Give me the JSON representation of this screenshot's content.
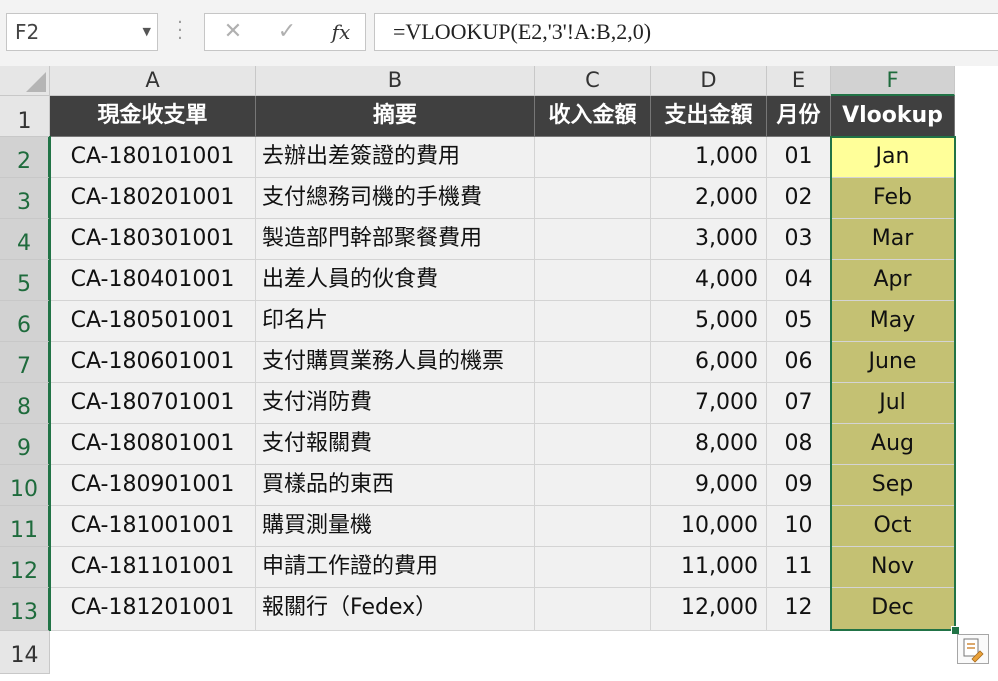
{
  "name_box": "F2",
  "formula_bar": {
    "cancel_icon": "✕",
    "enter_icon": "✓",
    "function_icon": "fx",
    "formula": "=VLOOKUP(E2,'3'!A:B,2,0)"
  },
  "columns": [
    "A",
    "B",
    "C",
    "D",
    "E",
    "F"
  ],
  "row_numbers": [
    "1",
    "2",
    "3",
    "4",
    "5",
    "6",
    "7",
    "8",
    "9",
    "10",
    "11",
    "12",
    "13",
    "14"
  ],
  "table": {
    "headers": [
      "現金收支單",
      "摘要",
      "收入金額",
      "支出金額",
      "月份",
      "Vlookup"
    ],
    "rows": [
      [
        "CA-180101001",
        "去辦出差簽證的費用",
        "",
        "1,000",
        "01",
        "Jan"
      ],
      [
        "CA-180201001",
        "支付總務司機的手機費",
        "",
        "2,000",
        "02",
        "Feb"
      ],
      [
        "CA-180301001",
        "製造部門幹部聚餐費用",
        "",
        "3,000",
        "03",
        "Mar"
      ],
      [
        "CA-180401001",
        "出差人員的伙食費",
        "",
        "4,000",
        "04",
        "Apr"
      ],
      [
        "CA-180501001",
        "印名片",
        "",
        "5,000",
        "05",
        "May"
      ],
      [
        "CA-180601001",
        "支付購買業務人員的機票",
        "",
        "6,000",
        "06",
        "June"
      ],
      [
        "CA-180701001",
        "支付消防費",
        "",
        "7,000",
        "07",
        "Jul"
      ],
      [
        "CA-180801001",
        "支付報關費",
        "",
        "8,000",
        "08",
        "Aug"
      ],
      [
        "CA-180901001",
        "買樣品的東西",
        "",
        "9,000",
        "09",
        "Sep"
      ],
      [
        "CA-181001001",
        "購買測量機",
        "",
        "10,000",
        "10",
        "Oct"
      ],
      [
        "CA-181101001",
        "申請工作證的費用",
        "",
        "11,000",
        "11",
        "Nov"
      ],
      [
        "CA-181201001",
        "報關行（Fedex）",
        "",
        "12,000",
        "12",
        "Dec"
      ]
    ]
  },
  "colors": {
    "header_fill": "#404040",
    "lookup_fill": "#c4c173",
    "active_cell_fill": "#ffff99",
    "selection_border": "#217346"
  },
  "icons": {
    "name_box_dropdown": "chevron-down-icon",
    "quick_analysis": "quick-analysis-icon"
  }
}
